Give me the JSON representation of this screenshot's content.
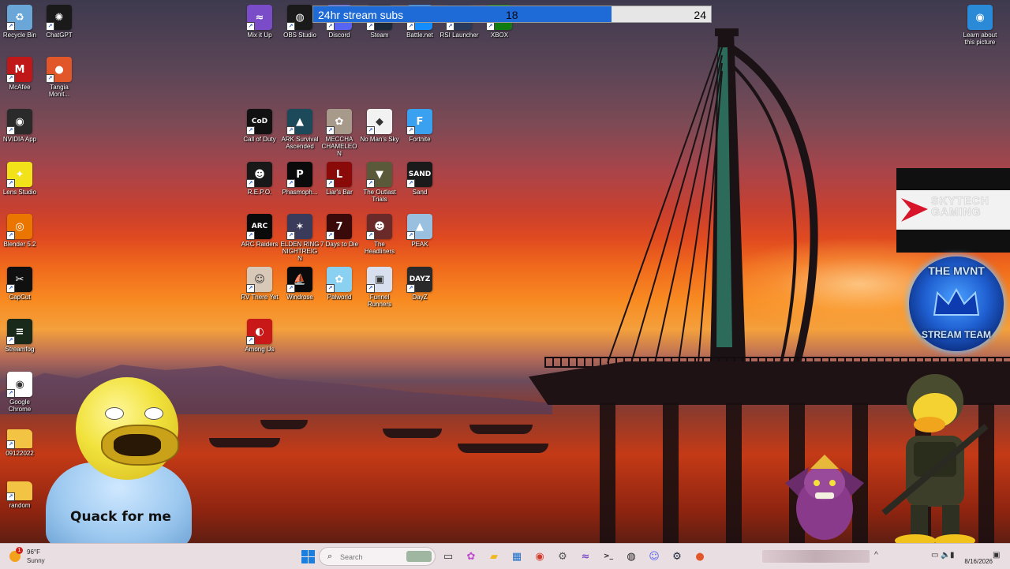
{
  "desktop": {
    "left_column": [
      {
        "label": "Recycle Bin",
        "icon": "recycle-bin-icon",
        "color": "#6aa6d8",
        "glyph": "♻"
      },
      {
        "label": "ChatGPT",
        "icon": "chatgpt-icon",
        "color": "#1a1a1a",
        "glyph": "✺"
      },
      {
        "label": "McAfee",
        "icon": "mcafee-icon",
        "color": "#c01818",
        "glyph": "M"
      },
      {
        "label": "Tangia Monit...",
        "icon": "tangia-icon",
        "color": "#e2572a",
        "glyph": "●"
      },
      {
        "label": "NVIDIA App",
        "icon": "nvidia-icon",
        "color": "#2a2a2a",
        "glyph": "◉"
      },
      {
        "label": "Lens Studio",
        "icon": "lens-studio-icon",
        "color": "#f1e21a",
        "glyph": "✦"
      },
      {
        "label": "Blender 5.2",
        "icon": "blender-icon",
        "color": "#ea7600",
        "glyph": "◎"
      },
      {
        "label": "CapCut",
        "icon": "capcut-icon",
        "color": "#101010",
        "glyph": "✂"
      },
      {
        "label": "Streamfog",
        "icon": "streamfog-icon",
        "color": "#1a2a1a",
        "glyph": "≡"
      },
      {
        "label": "Google Chrome",
        "icon": "chrome-icon",
        "color": "#ffffff",
        "glyph": "◉"
      },
      {
        "label": "09122022",
        "icon": "folder-icon",
        "color": "#f3c443",
        "glyph": ""
      },
      {
        "label": "random",
        "icon": "folder-icon",
        "color": "#f3c443",
        "glyph": ""
      }
    ],
    "top_row": [
      {
        "label": "Mix it Up",
        "icon": "mix-it-up-icon",
        "color": "#7a4cc8",
        "glyph": "≈"
      },
      {
        "label": "OBS Studio",
        "icon": "obs-icon",
        "color": "#1a1a1a",
        "glyph": "◍"
      },
      {
        "label": "Discord",
        "icon": "discord-icon",
        "color": "#5865f2",
        "glyph": "☺"
      },
      {
        "label": "Steam",
        "icon": "steam-icon",
        "color": "#1b2838",
        "glyph": "⚙"
      },
      {
        "label": "Battle.net",
        "icon": "battlenet-icon",
        "color": "#148eff",
        "glyph": "⚡"
      },
      {
        "label": "RSI Launcher",
        "icon": "rsi-launcher-icon",
        "color": "#2a3a5a",
        "glyph": "◆"
      },
      {
        "label": "XBOX",
        "icon": "xbox-icon",
        "color": "#107c10",
        "glyph": "✕"
      }
    ],
    "games": [
      {
        "label": "Call of Duty",
        "icon": "call-of-duty-icon",
        "color": "#111111",
        "glyph": "CoD"
      },
      {
        "label": "ARK Survival Ascended",
        "icon": "ark-icon",
        "color": "#1d4a5a",
        "glyph": "▲"
      },
      {
        "label": "MECCHA CHAMELEON",
        "icon": "meccha-chameleon-icon",
        "color": "#a89a8a",
        "glyph": "✿"
      },
      {
        "label": "No Man's Sky",
        "icon": "no-mans-sky-icon",
        "color": "#f2f2f2",
        "glyph": "◆"
      },
      {
        "label": "Fortnite",
        "icon": "fortnite-icon",
        "color": "#3aa0f0",
        "glyph": "F"
      },
      {
        "label": "R.E.P.O.",
        "icon": "repo-icon",
        "color": "#181818",
        "glyph": "☻"
      },
      {
        "label": "Phasmoph...",
        "icon": "phasmophobia-icon",
        "color": "#0a0a0a",
        "glyph": "P"
      },
      {
        "label": "Liar's Bar",
        "icon": "liars-bar-icon",
        "color": "#8a0a0a",
        "glyph": "L"
      },
      {
        "label": "The Outlast Trials",
        "icon": "outlast-trials-icon",
        "color": "#5a5a3a",
        "glyph": "▼"
      },
      {
        "label": "Sand",
        "icon": "sand-icon",
        "color": "#1a1a1a",
        "glyph": "SAND"
      },
      {
        "label": "ARC Raiders",
        "icon": "arc-raiders-icon",
        "color": "#0a0a0a",
        "glyph": "ARC"
      },
      {
        "label": "ELDEN RING NIGHTREIGN",
        "icon": "elden-ring-icon",
        "color": "#3a3a5a",
        "glyph": "✶"
      },
      {
        "label": "7 Days to Die",
        "icon": "7-days-to-die-icon",
        "color": "#3a0a0a",
        "glyph": "7"
      },
      {
        "label": "The Headliners",
        "icon": "headliners-icon",
        "color": "#6a2a2a",
        "glyph": "☻"
      },
      {
        "label": "PEAK",
        "icon": "peak-icon",
        "color": "#9ac0e0",
        "glyph": "▲"
      },
      {
        "label": "RV There Yet",
        "icon": "rv-there-yet-icon",
        "color": "#d8c8b8",
        "glyph": "☺"
      },
      {
        "label": "Windrose",
        "icon": "windrose-icon",
        "color": "#0a0a0a",
        "glyph": "⛵"
      },
      {
        "label": "Palworld",
        "icon": "palworld-icon",
        "color": "#8ad0f0",
        "glyph": "✿"
      },
      {
        "label": "Funnel Runners",
        "icon": "funnel-runners-icon",
        "color": "#d8e0ef",
        "glyph": "▣"
      },
      {
        "label": "DayZ",
        "icon": "dayz-icon",
        "color": "#2a2a2a",
        "glyph": "DAYZ"
      },
      {
        "label": "Among Us",
        "icon": "among-us-icon",
        "color": "#c81818",
        "glyph": "◐"
      }
    ],
    "learn_about": {
      "label": "Learn about this picture",
      "icon": "learn-about-picture-icon"
    }
  },
  "overlays": {
    "subs": {
      "title": "24hr stream subs",
      "current": "18",
      "goal": "24",
      "fill_fraction": 0.75,
      "fill_color": "#1e6ad6"
    },
    "skytech": {
      "text": "SKYTECH GAMING"
    },
    "mvnt": {
      "top": "THE MVNT",
      "bottom": "STREAM TEAM"
    },
    "duck": {
      "caption": "Quack for me"
    }
  },
  "taskbar": {
    "weather": {
      "temp": "96°F",
      "condition": "Sunny",
      "alert_count": "1"
    },
    "search": {
      "placeholder": "Search"
    },
    "pinned": [
      {
        "icon": "windows-start-icon",
        "color": "#1b7fe0"
      },
      {
        "icon": "task-view-icon",
        "color": "#333333",
        "glyph": "▭"
      },
      {
        "icon": "copilot-icon",
        "color": "#c04ad0",
        "glyph": "✿"
      },
      {
        "icon": "file-explorer-icon",
        "color": "#f0b81c",
        "glyph": "▰"
      },
      {
        "icon": "microsoft-store-icon",
        "color": "#1b6fc8",
        "glyph": "▦"
      },
      {
        "icon": "chrome-taskbar-icon",
        "color": "#d83a2a",
        "glyph": "◉"
      },
      {
        "icon": "settings-gear-icon",
        "color": "#555555",
        "glyph": "⚙"
      },
      {
        "icon": "mix-it-up-taskbar-icon",
        "color": "#7a4cc8",
        "glyph": "≈"
      },
      {
        "icon": "terminal-icon",
        "color": "#222222",
        "glyph": ">_"
      },
      {
        "icon": "obs-taskbar-icon",
        "color": "#222222",
        "glyph": "◍"
      },
      {
        "icon": "discord-taskbar-icon",
        "color": "#5865f2",
        "glyph": "☺"
      },
      {
        "icon": "steam-taskbar-icon",
        "color": "#1b2838",
        "glyph": "⚙"
      },
      {
        "icon": "tangia-taskbar-icon",
        "color": "#e2572a",
        "glyph": "●"
      }
    ],
    "tray": {
      "date": "8/16/2026"
    }
  }
}
